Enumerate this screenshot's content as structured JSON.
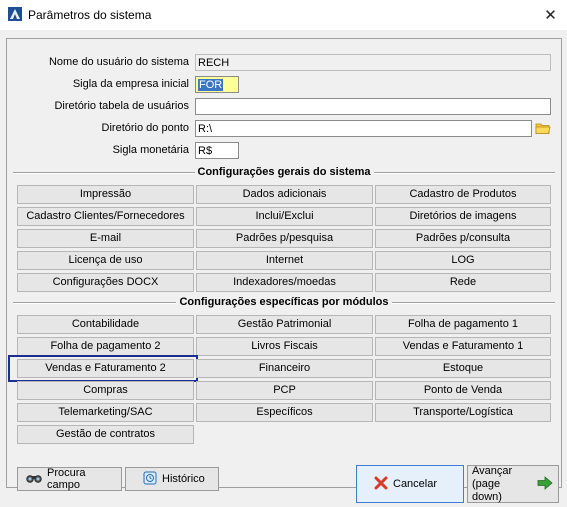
{
  "window": {
    "title": "Parâmetros do sistema",
    "close_glyph": "✕"
  },
  "fields": [
    {
      "label": "Nome do usuário do sistema",
      "value": "RECH"
    },
    {
      "label": "Sigla da empresa inicial",
      "value": "FOR"
    },
    {
      "label": "Diretório tabela de usuários",
      "value": ""
    },
    {
      "label": "Diretório do ponto",
      "value": "R:\\"
    },
    {
      "label": "Sigla monetária",
      "value": "R$"
    }
  ],
  "sections": {
    "general": {
      "title": "Configurações gerais do sistema",
      "buttons": [
        "Impressão",
        "Dados adicionais",
        "Cadastro de Produtos",
        "Cadastro Clientes/Fornecedores",
        "Inclui/Exclui",
        "Diretórios de imagens",
        "E-mail",
        "Padrões p/pesquisa",
        "Padrões p/consulta",
        "Licença de uso",
        "Internet",
        "LOG",
        "Configurações DOCX",
        "Indexadores/moedas",
        "Rede"
      ]
    },
    "modules": {
      "title": "Configurações específicas por módulos",
      "buttons": [
        "Contabilidade",
        "Gestão Patrimonial",
        "Folha de pagamento 1",
        "Folha de pagamento 2",
        "Livros Fiscais",
        "Vendas e Faturamento 1",
        "Vendas e Faturamento 2",
        "Financeiro",
        "Estoque",
        "Compras",
        "PCP",
        "Ponto de Venda",
        "Telemarketing/SAC",
        "Específicos",
        "Transporte/Logística",
        "Gestão de contratos"
      ]
    }
  },
  "footer": {
    "procura": "Procura campo",
    "historico": "Histórico",
    "cancelar": "Cancelar",
    "avancar_line1": "Avançar",
    "avancar_line2": "(page down)"
  },
  "icons": {
    "app": "app-icon",
    "folder": "folder-icon",
    "binoculars": "binoculars-icon",
    "history": "history-icon",
    "cancel": "cancel-x-icon",
    "next": "arrow-right-icon"
  },
  "colors": {
    "highlight_field": "#ffff99",
    "selection": "#3a76c4",
    "focus_ring": "#1a2f8f",
    "cancel_icon": "#d93b2b",
    "next_icon": "#3aa13a"
  }
}
